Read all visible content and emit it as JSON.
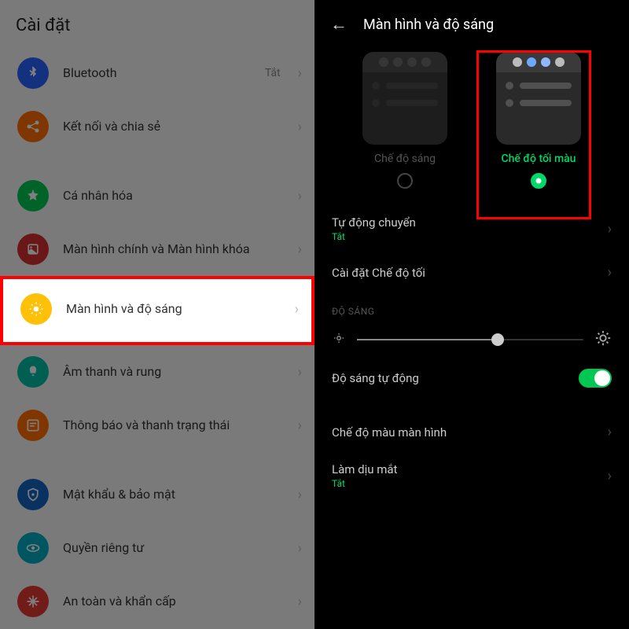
{
  "left": {
    "title": "Cài đặt",
    "items": [
      {
        "icon": "bluetooth",
        "color": "bg-blue",
        "label": "Bluetooth",
        "value": "Tắt"
      },
      {
        "icon": "share",
        "color": "bg-orange",
        "label": "Kết nối và chia sẻ"
      },
      {
        "icon": "personalize",
        "color": "bg-green",
        "label": "Cá nhân hóa"
      },
      {
        "icon": "home",
        "color": "bg-red",
        "label": "Màn hình chính và Màn hình khóa"
      },
      {
        "icon": "brightness",
        "color": "bg-yellow",
        "label": "Màn hình và độ sáng",
        "highlight": true
      },
      {
        "icon": "sound",
        "color": "bg-teal",
        "label": "Âm thanh và rung"
      },
      {
        "icon": "notif",
        "color": "bg-orange2",
        "label": "Thông báo và thanh trạng thái"
      },
      {
        "icon": "lock",
        "color": "bg-blue2",
        "label": "Mật khẩu & bảo mật"
      },
      {
        "icon": "privacy",
        "color": "bg-cyan",
        "label": "Quyền riêng tư"
      },
      {
        "icon": "emergency",
        "color": "bg-red2",
        "label": "An toàn và khẩn cấp"
      }
    ]
  },
  "right": {
    "title": "Màn hình và độ sáng",
    "modes": {
      "light": "Chế độ sáng",
      "dark": "Chế độ tối màu"
    },
    "auto_switch": {
      "label": "Tự động chuyển",
      "value": "Tắt"
    },
    "dark_settings": {
      "label": "Cài đặt Chế độ tối"
    },
    "brightness_section": "ĐỘ SÁNG",
    "auto_brightness": {
      "label": "Độ sáng tự động"
    },
    "screen_color": {
      "label": "Chế độ màu màn hình"
    },
    "eye_comfort": {
      "label": "Làm dịu mắt",
      "value": "Tắt"
    }
  }
}
